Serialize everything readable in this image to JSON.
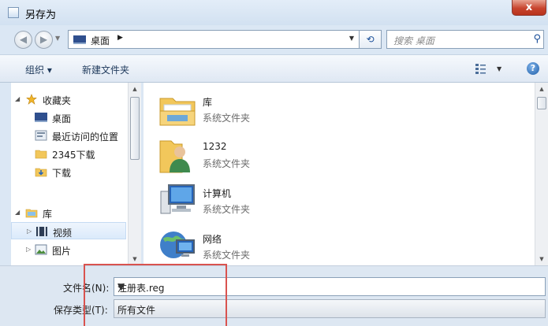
{
  "window": {
    "title": "另存为",
    "close_glyph": "x"
  },
  "address_bar": {
    "path": "桌面",
    "search_placeholder": "搜索 桌面"
  },
  "toolbar": {
    "organize": "组织 ▾",
    "new_folder": "新建文件夹"
  },
  "nav_pane": {
    "items": [
      {
        "label": "收藏夹",
        "icon": "star-icon"
      },
      {
        "label": "桌面",
        "icon": "desktop-icon"
      },
      {
        "label": "最近访问的位置",
        "icon": "recent-places-icon"
      },
      {
        "label": "2345下载",
        "icon": "folder-icon"
      },
      {
        "label": "下载",
        "icon": "download-folder-icon"
      },
      {
        "label": "库",
        "icon": "library-icon"
      },
      {
        "label": "视频",
        "icon": "video-icon"
      },
      {
        "label": "图片",
        "icon": "picture-icon"
      }
    ]
  },
  "file_pane": {
    "items": [
      {
        "name": "库",
        "type": "系统文件夹",
        "icon": "library-folder-icon"
      },
      {
        "name": "1232",
        "type": "系统文件夹",
        "icon": "user-folder-icon"
      },
      {
        "name": "计算机",
        "type": "系统文件夹",
        "icon": "computer-icon"
      },
      {
        "name": "网络",
        "type": "系统文件夹",
        "icon": "network-icon"
      }
    ]
  },
  "save_fields": {
    "filename_label": "文件名(N):",
    "filename_value": "注册表.reg",
    "filetype_label": "保存类型(T):",
    "filetype_value": "所有文件"
  },
  "colors": {
    "highlight_box": "#d9534f",
    "selection": "#dbeafb"
  }
}
